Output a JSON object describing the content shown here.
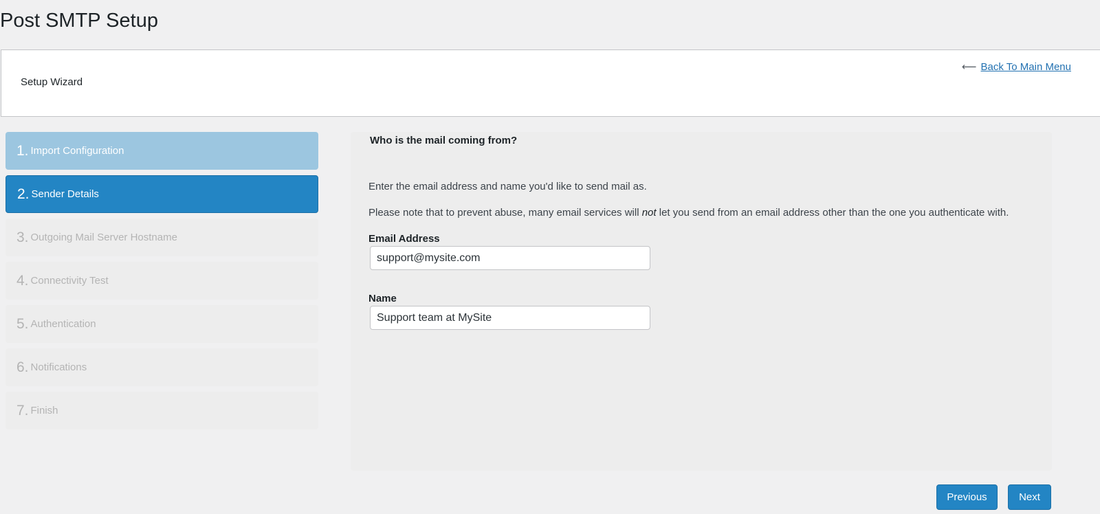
{
  "page": {
    "title": "Post SMTP Setup"
  },
  "header": {
    "wizard_label": "Setup Wizard",
    "back_arrow": "⟵",
    "back_link": "Back To Main Menu"
  },
  "steps": [
    {
      "num": "1.",
      "label": "Import Configuration",
      "state": "done"
    },
    {
      "num": "2.",
      "label": "Sender Details",
      "state": "active"
    },
    {
      "num": "3.",
      "label": "Outgoing Mail Server Hostname",
      "state": "pending"
    },
    {
      "num": "4.",
      "label": "Connectivity Test",
      "state": "pending"
    },
    {
      "num": "5.",
      "label": "Authentication",
      "state": "pending"
    },
    {
      "num": "6.",
      "label": "Notifications",
      "state": "pending"
    },
    {
      "num": "7.",
      "label": "Finish",
      "state": "pending"
    }
  ],
  "main": {
    "heading": "Who is the mail coming from?",
    "description1": "Enter the email address and name you'd like to send mail as.",
    "description2_before": "Please note that to prevent abuse, many email services will ",
    "description2_emphasis": "not",
    "description2_after": " let you send from an email address other than the one you authenticate with.",
    "email_label": "Email Address",
    "email_value": "support@mysite.com",
    "name_label": "Name",
    "name_value": "Support team at MySite"
  },
  "buttons": {
    "previous": "Previous",
    "next": "Next"
  },
  "colors": {
    "active_step": "#2385c4",
    "done_step": "#9cc6e0",
    "pending_step": "#ededed",
    "link": "#2271b1"
  }
}
